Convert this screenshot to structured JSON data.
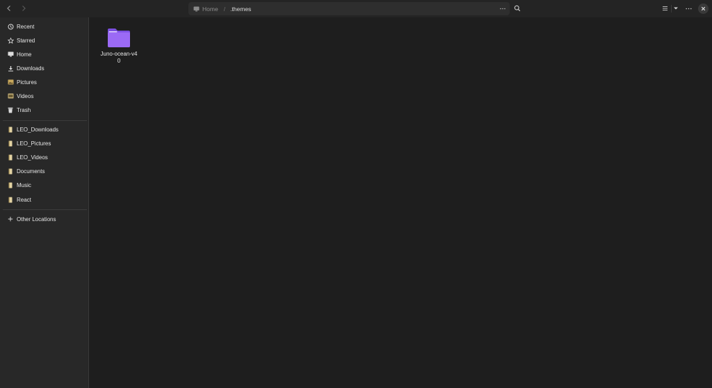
{
  "header": {
    "back_icon": "chevron-left-icon",
    "forward_icon": "chevron-right-icon",
    "path": {
      "home_label": "Home",
      "separator": "/",
      "current": ".themes",
      "menu_icon": "more-horizontal-icon"
    },
    "search_icon": "search-icon",
    "view_list_icon": "list-view-icon",
    "view_options_icon": "dropdown-arrow-icon",
    "main_menu_icon": "more-horizontal-icon",
    "close_icon": "close-icon"
  },
  "sidebar": {
    "places": [
      {
        "label": "Recent",
        "icon": "clock-icon"
      },
      {
        "label": "Starred",
        "icon": "star-icon"
      },
      {
        "label": "Home",
        "icon": "home-icon"
      },
      {
        "label": "Downloads",
        "icon": "download-icon"
      },
      {
        "label": "Pictures",
        "icon": "pictures-icon"
      },
      {
        "label": "Videos",
        "icon": "videos-icon"
      },
      {
        "label": "Trash",
        "icon": "trash-icon"
      }
    ],
    "bookmarks": [
      {
        "label": "LEO_Downloads",
        "icon": "folder-bookmark-icon"
      },
      {
        "label": "LEO_Pictures",
        "icon": "folder-bookmark-icon"
      },
      {
        "label": "LEO_Videos",
        "icon": "folder-bookmark-icon"
      },
      {
        "label": "Documents",
        "icon": "folder-bookmark-icon"
      },
      {
        "label": "Music",
        "icon": "folder-bookmark-icon"
      },
      {
        "label": "React",
        "icon": "folder-bookmark-icon"
      }
    ],
    "other": {
      "label": "Other Locations",
      "icon": "plus-icon"
    }
  },
  "content": {
    "items": [
      {
        "name": "Juno-ocean-v40",
        "icon": "folder-icon",
        "color": "#8b5cf6"
      }
    ]
  }
}
